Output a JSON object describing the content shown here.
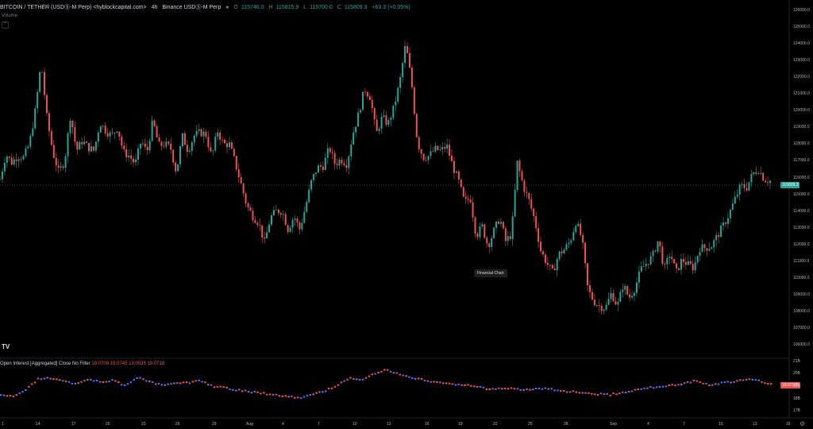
{
  "header": {
    "symbol": "BITCOIN / TETHER (USDⓈ-M Perp) <hyblockcapital.com>",
    "interval": "4h",
    "exchange": "Binance USDⓈ-M Perp",
    "o_key": "O",
    "o_val": "115746.0",
    "h_key": "H",
    "h_val": "115815.9",
    "l_key": "L",
    "l_val": "115700.0",
    "c_key": "C",
    "c_val": "115809.3",
    "change": "+63.3 (+0.05%)",
    "volume_label": "Volume"
  },
  "tooltip": "Financial Chart",
  "logo": "TV",
  "price_badge": "115809.3",
  "oi": {
    "label": "Open Interest [Aggregated] Close No Filter",
    "values": "19.0708  19.0745  19.0035  19.0718",
    "badge": "19.0718B",
    "ticks": [
      "21B",
      "20B",
      "19B",
      "18B",
      "17B"
    ]
  },
  "price_axis": [
    "126000.0",
    "125000.0",
    "124000.0",
    "123000.0",
    "122000.0",
    "121000.0",
    "120000.0",
    "119000.0",
    "118000.0",
    "117000.0",
    "116000.0",
    "115000.0",
    "114000.0",
    "113000.0",
    "112000.0",
    "111000.0",
    "110000.0",
    "109000.0",
    "108000.0",
    "107000.0",
    "106000.0"
  ],
  "time_axis": [
    "1",
    "14",
    "17",
    "20",
    "23",
    "26",
    "29",
    "Aug",
    "4",
    "7",
    "10",
    "13",
    "16",
    "19",
    "22",
    "25",
    "28",
    "Sep",
    "4",
    "7",
    "10",
    "13",
    "16"
  ],
  "colors": {
    "up": "#26a69a",
    "down": "#ef5350",
    "oi_up": "#5b6cff",
    "oi_down": "#ef5350",
    "bg": "#000000"
  },
  "chart_data": {
    "type": "candlestick",
    "price_range": [
      106000,
      126500
    ],
    "close_path": [
      115900,
      117400,
      116900,
      117300,
      117200,
      118000,
      120000,
      122900,
      119500,
      117500,
      116300,
      117000,
      119800,
      117600,
      118200,
      117800,
      117600,
      119300,
      118800,
      118500,
      119000,
      117500,
      117300,
      116800,
      118200,
      117500,
      119400,
      117900,
      118000,
      117800,
      116300,
      118500,
      117600,
      118500,
      118700,
      118600,
      117200,
      118800,
      118000,
      118000,
      116900,
      115600,
      114300,
      113700,
      113300,
      112100,
      113600,
      114000,
      114000,
      112900,
      113700,
      112900,
      114300,
      115800,
      116600,
      116700,
      117800,
      116800,
      117100,
      116800,
      118600,
      119800,
      121300,
      120800,
      118600,
      119600,
      119200,
      120200,
      121700,
      124000,
      121700,
      118100,
      117200,
      117300,
      117700,
      117600,
      117900,
      116700,
      115800,
      114500,
      114800,
      112500,
      113100,
      111900,
      112800,
      113600,
      112200,
      112600,
      116900,
      115500,
      114600,
      113400,
      111600,
      110900,
      110300,
      111400,
      111700,
      112200,
      113400,
      112300,
      109300,
      108600,
      108300,
      108200,
      109100,
      108300,
      109600,
      108800,
      109400,
      110500,
      110900,
      111300,
      112300,
      110500,
      111500,
      110300,
      111100,
      110800,
      110600,
      111800,
      111800,
      111900,
      112500,
      113100,
      113800,
      114700,
      115500,
      115400,
      116200,
      116500,
      115900,
      115800
    ]
  }
}
